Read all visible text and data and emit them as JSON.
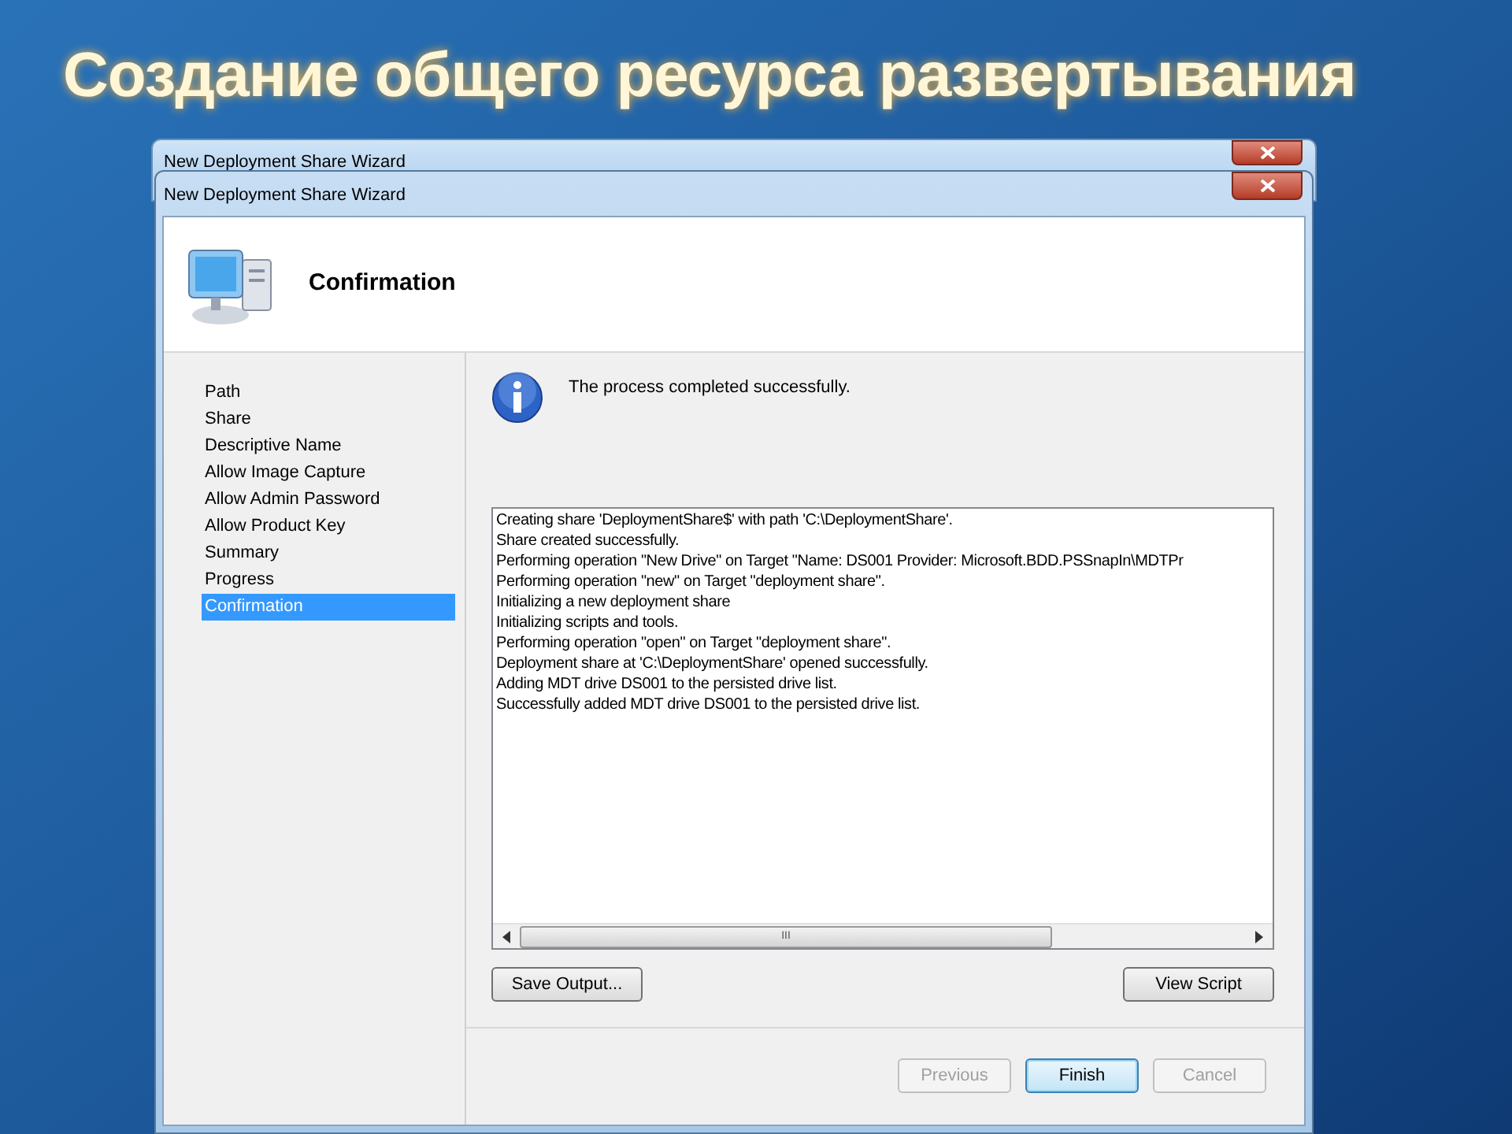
{
  "slide_title": "Создание общего ресурса развертывания",
  "back_window": {
    "title": "New Deployment Share Wizard"
  },
  "window": {
    "title": "New Deployment Share Wizard"
  },
  "header": {
    "title": "Confirmation"
  },
  "steps": [
    {
      "label": "Path",
      "selected": false
    },
    {
      "label": "Share",
      "selected": false
    },
    {
      "label": "Descriptive Name",
      "selected": false
    },
    {
      "label": "Allow Image Capture",
      "selected": false
    },
    {
      "label": "Allow Admin Password",
      "selected": false
    },
    {
      "label": "Allow Product Key",
      "selected": false
    },
    {
      "label": "Summary",
      "selected": false
    },
    {
      "label": "Progress",
      "selected": false
    },
    {
      "label": "Confirmation",
      "selected": true
    }
  ],
  "message": "The process completed successfully.",
  "log_lines": [
    "Creating share 'DeploymentShare$' with path 'C:\\DeploymentShare'.",
    "Share created successfully.",
    "Performing operation \"New Drive\" on Target \"Name: DS001 Provider: Microsoft.BDD.PSSnapIn\\MDTPr",
    "Performing operation \"new\" on Target \"deployment share\".",
    "Initializing a new deployment share",
    "Initializing scripts and tools.",
    "Performing operation \"open\" on Target \"deployment share\".",
    "Deployment share at 'C:\\DeploymentShare' opened successfully.",
    "Adding MDT drive DS001 to the persisted drive list.",
    "Successfully added MDT drive DS001 to the persisted drive list."
  ],
  "scrollbar_grip": "III",
  "output_buttons": [
    {
      "label": "Save Output..."
    },
    {
      "label": "View Script"
    }
  ],
  "nav_buttons": [
    {
      "label": "Previous",
      "disabled": true,
      "default": false
    },
    {
      "label": "Finish",
      "disabled": false,
      "default": true
    },
    {
      "label": "Cancel",
      "disabled": true,
      "default": false
    }
  ]
}
